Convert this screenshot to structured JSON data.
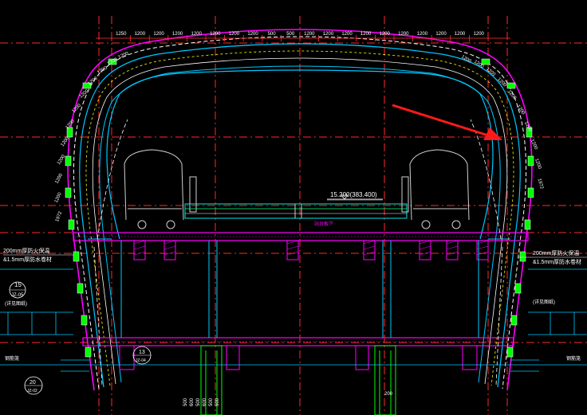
{
  "drawing": {
    "top_dims": [
      "1250",
      "1200",
      "1200",
      "1200",
      "1200",
      "1200",
      "1200",
      "1200",
      "500",
      "500",
      "1200",
      "1200",
      "1200",
      "1200",
      "1200",
      "1200",
      "1200",
      "1200",
      "1200",
      "1200"
    ],
    "left_arc_dims": [
      "1972",
      "1200",
      "1200",
      "1200",
      "1200",
      "1200",
      "1200",
      "1200",
      "1200",
      "1200",
      "1200",
      "1200"
    ],
    "right_arc_dims": [
      "1200",
      "1200",
      "1200",
      "1200",
      "1200",
      "1200",
      "1200",
      "1200",
      "1200",
      "1972"
    ],
    "elevation_label": "15.200(383.400)",
    "platform_note": "站台板下",
    "left_note_1": "200mm厚防火保温",
    "left_note_2": "&1.5mm厚防水卷材",
    "right_note_1": "200mm厚防火保温",
    "right_note_2": "&1.5mm厚防水卷材",
    "left_dim_15": "15",
    "left_sub_15": "JZ-05",
    "left_side_note": "(详见图纸)",
    "right_side_note": "(详见图纸)",
    "left_bottom_label": "钢筋笼",
    "right_bottom_label": "钢筋笼",
    "callout_13": "13",
    "callout_13_sub": "JZ-04",
    "callout_20": "20",
    "callout_20_sub": "JZ-02",
    "col_dims": [
      "500",
      "600",
      "500",
      "600",
      "500",
      "500"
    ],
    "right_col_dim": "200"
  },
  "colors": {
    "background": "#000000",
    "axis_red": "#ff2a2a",
    "dim_red": "#ff3333",
    "magenta": "#ff00ff",
    "cyan": "#00c8ff",
    "green": "#00ff00",
    "yellow": "#ffff00",
    "white": "#ffffff",
    "grey": "#cccccc",
    "arrow": "#ff1a1a"
  }
}
